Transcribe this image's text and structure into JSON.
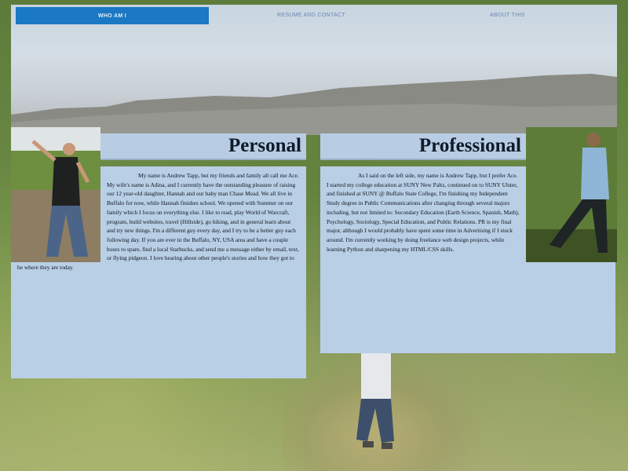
{
  "nav": {
    "items": [
      {
        "label": "Who am I",
        "active": true
      },
      {
        "label": "Resume and Contact",
        "active": false
      },
      {
        "label": "About this",
        "active": false
      }
    ]
  },
  "personal": {
    "title": "Personal",
    "text": "My name is Andrew Tapp, but my friends and family all call me Ace. My wife's name is Adina, and I currently have the outstanding pleasure of raising our 12 year-old daughter, Hannah and our baby man Chase Mead. We all live in Buffalo for now, while Hannah finishes school. We opened with Summer on our family which I focus on everything else. I like to read, play World of Warcraft, program, build websites, travel (Hillside), go hiking, and in general learn about and try new things. I'm a different guy every day, and I try to be a better guy each following day. If you are ever in the Buffalo, NY, USA area and have a couple hours to spare, find a local Starbucks, and send me a message either by email, text, or flying pidgeon. I love hearing about other people's stories and how they got to be where they are today."
  },
  "professional": {
    "title": "Professional",
    "text": "As I said on the left side, my name is Andrew Tapp, but I prefer Ace. I started my college education at SUNY New Paltz, continued on to SUNY Ulster, and finished at SUNY @ Buffalo State College, I'm finishing my Independent Study degree in Public Communications after changing through several majors including, but not limited to: Secondary Education (Earth Science, Spanish, Math), Psychology, Sociology, Special Education, and Public Relations. PR is my final major, although I would probably have spent some time in Advertising if I stuck around. I'm currently working by doing freelance web design projects, while learning Python and sharpening my HTML/CSS skills."
  },
  "colors": {
    "nav_active": "#1a78c4",
    "panel": "#b9cfe5",
    "title": "#0f1a2a"
  }
}
